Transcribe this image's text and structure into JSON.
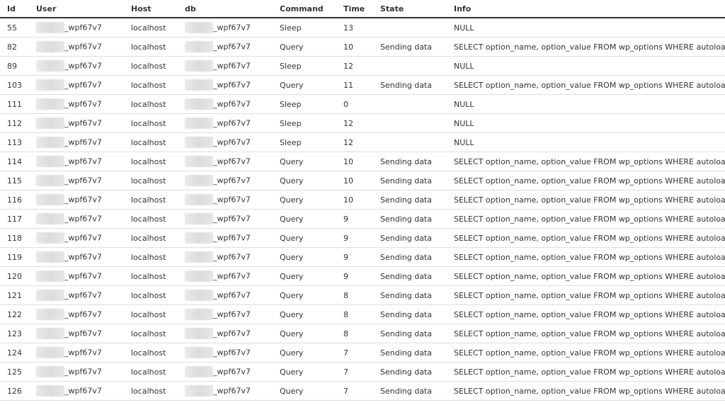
{
  "headers": {
    "id": "Id",
    "user": "User",
    "host": "Host",
    "db": "db",
    "command": "Command",
    "time": "Time",
    "state": "State",
    "info": "Info"
  },
  "rows": [
    {
      "id": "55",
      "user_suffix": "_wpf67v7",
      "host": "localhost",
      "db_suffix": "_wpf67v7",
      "command": "Sleep",
      "time": "13",
      "state": "",
      "info": "NULL"
    },
    {
      "id": "82",
      "user_suffix": "_wpf67v7",
      "host": "localhost",
      "db_suffix": "_wpf67v7",
      "command": "Query",
      "time": "10",
      "state": "Sending data",
      "info": "SELECT option_name, option_value FROM wp_options WHERE autoload = 'yes'"
    },
    {
      "id": "89",
      "user_suffix": "_wpf67v7",
      "host": "localhost",
      "db_suffix": "_wpf67v7",
      "command": "Sleep",
      "time": "12",
      "state": "",
      "info": "NULL"
    },
    {
      "id": "103",
      "user_suffix": "_wpf67v7",
      "host": "localhost",
      "db_suffix": "_wpf67v7",
      "command": "Query",
      "time": "11",
      "state": "Sending data",
      "info": "SELECT option_name, option_value FROM wp_options WHERE autoload = 'yes'"
    },
    {
      "id": "111",
      "user_suffix": "_wpf67v7",
      "host": "localhost",
      "db_suffix": "_wpf67v7",
      "command": "Sleep",
      "time": "0",
      "state": "",
      "info": "NULL"
    },
    {
      "id": "112",
      "user_suffix": "_wpf67v7",
      "host": "localhost",
      "db_suffix": "_wpf67v7",
      "command": "Sleep",
      "time": "12",
      "state": "",
      "info": "NULL"
    },
    {
      "id": "113",
      "user_suffix": "_wpf67v7",
      "host": "localhost",
      "db_suffix": "_wpf67v7",
      "command": "Sleep",
      "time": "12",
      "state": "",
      "info": "NULL"
    },
    {
      "id": "114",
      "user_suffix": "_wpf67v7",
      "host": "localhost",
      "db_suffix": "_wpf67v7",
      "command": "Query",
      "time": "10",
      "state": "Sending data",
      "info": "SELECT option_name, option_value FROM wp_options WHERE autoload = 'yes'"
    },
    {
      "id": "115",
      "user_suffix": "_wpf67v7",
      "host": "localhost",
      "db_suffix": "_wpf67v7",
      "command": "Query",
      "time": "10",
      "state": "Sending data",
      "info": "SELECT option_name, option_value FROM wp_options WHERE autoload = 'yes'"
    },
    {
      "id": "116",
      "user_suffix": "_wpf67v7",
      "host": "localhost",
      "db_suffix": "_wpf67v7",
      "command": "Query",
      "time": "10",
      "state": "Sending data",
      "info": "SELECT option_name, option_value FROM wp_options WHERE autoload = 'yes'"
    },
    {
      "id": "117",
      "user_suffix": "_wpf67v7",
      "host": "localhost",
      "db_suffix": "_wpf67v7",
      "command": "Query",
      "time": "9",
      "state": "Sending data",
      "info": "SELECT option_name, option_value FROM wp_options WHERE autoload = 'yes'"
    },
    {
      "id": "118",
      "user_suffix": "_wpf67v7",
      "host": "localhost",
      "db_suffix": "_wpf67v7",
      "command": "Query",
      "time": "9",
      "state": "Sending data",
      "info": "SELECT option_name, option_value FROM wp_options WHERE autoload = 'yes'"
    },
    {
      "id": "119",
      "user_suffix": "_wpf67v7",
      "host": "localhost",
      "db_suffix": "_wpf67v7",
      "command": "Query",
      "time": "9",
      "state": "Sending data",
      "info": "SELECT option_name, option_value FROM wp_options WHERE autoload = 'yes'"
    },
    {
      "id": "120",
      "user_suffix": "_wpf67v7",
      "host": "localhost",
      "db_suffix": "_wpf67v7",
      "command": "Query",
      "time": "9",
      "state": "Sending data",
      "info": "SELECT option_name, option_value FROM wp_options WHERE autoload = 'yes'"
    },
    {
      "id": "121",
      "user_suffix": "_wpf67v7",
      "host": "localhost",
      "db_suffix": "_wpf67v7",
      "command": "Query",
      "time": "8",
      "state": "Sending data",
      "info": "SELECT option_name, option_value FROM wp_options WHERE autoload = 'yes'"
    },
    {
      "id": "122",
      "user_suffix": "_wpf67v7",
      "host": "localhost",
      "db_suffix": "_wpf67v7",
      "command": "Query",
      "time": "8",
      "state": "Sending data",
      "info": "SELECT option_name, option_value FROM wp_options WHERE autoload = 'yes'"
    },
    {
      "id": "123",
      "user_suffix": "_wpf67v7",
      "host": "localhost",
      "db_suffix": "_wpf67v7",
      "command": "Query",
      "time": "8",
      "state": "Sending data",
      "info": "SELECT option_name, option_value FROM wp_options WHERE autoload = 'yes'"
    },
    {
      "id": "124",
      "user_suffix": "_wpf67v7",
      "host": "localhost",
      "db_suffix": "_wpf67v7",
      "command": "Query",
      "time": "7",
      "state": "Sending data",
      "info": "SELECT option_name, option_value FROM wp_options WHERE autoload = 'yes'"
    },
    {
      "id": "125",
      "user_suffix": "_wpf67v7",
      "host": "localhost",
      "db_suffix": "_wpf67v7",
      "command": "Query",
      "time": "7",
      "state": "Sending data",
      "info": "SELECT option_name, option_value FROM wp_options WHERE autoload = 'yes'"
    },
    {
      "id": "126",
      "user_suffix": "_wpf67v7",
      "host": "localhost",
      "db_suffix": "_wpf67v7",
      "command": "Query",
      "time": "7",
      "state": "Sending data",
      "info": "SELECT option_name, option_value FROM wp_options WHERE autoload = 'yes'"
    }
  ],
  "colors": {
    "text": "#333333",
    "header_rule": "#333333",
    "row_rule": "#dedede",
    "redaction": "#e2e2e2"
  }
}
